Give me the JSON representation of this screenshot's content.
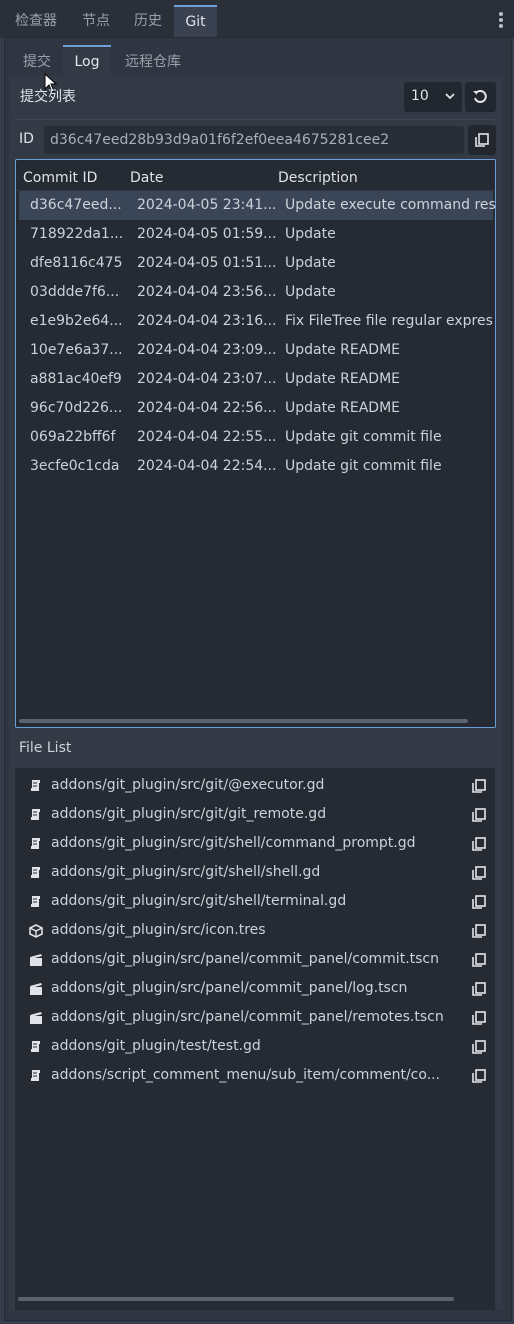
{
  "top_tabs": [
    "检查器",
    "节点",
    "历史",
    "Git"
  ],
  "sub_tabs": [
    "提交",
    "Log",
    "远程仓库"
  ],
  "commit_list": {
    "title": "提交列表",
    "count": "10",
    "id_label": "ID",
    "id_value": "d36c47eed28b93d9a01f6f2ef0eea4675281cee2"
  },
  "table": {
    "headers": [
      "Commit ID",
      "Date",
      "Description"
    ],
    "rows": [
      {
        "id": "d36c47eed...",
        "date": "2024-04-05 23:41...",
        "desc": "Update execute command res"
      },
      {
        "id": "718922da1...",
        "date": "2024-04-05 01:59...",
        "desc": "Update"
      },
      {
        "id": "dfe8116c475",
        "date": "2024-04-05 01:51...",
        "desc": "Update"
      },
      {
        "id": "03ddde7f6...",
        "date": "2024-04-04 23:56...",
        "desc": "Update"
      },
      {
        "id": "e1e9b2e64...",
        "date": "2024-04-04 23:16...",
        "desc": "Fix FileTree file regular expres"
      },
      {
        "id": "10e7e6a37...",
        "date": "2024-04-04 23:09...",
        "desc": "Update README"
      },
      {
        "id": "a881ac40ef9",
        "date": "2024-04-04 23:07...",
        "desc": "Update README"
      },
      {
        "id": "96c70d226...",
        "date": "2024-04-04 22:56...",
        "desc": "Update README"
      },
      {
        "id": "069a22bff6f",
        "date": "2024-04-04 22:55...",
        "desc": "Update git commit file"
      },
      {
        "id": "3ecfe0c1cda",
        "date": "2024-04-04 22:54...",
        "desc": "Update git commit file"
      }
    ]
  },
  "file_list": {
    "title": "File List",
    "files": [
      {
        "name": "addons/git_plugin/src/git/@executor.gd",
        "icon": "script-icon"
      },
      {
        "name": "addons/git_plugin/src/git/git_remote.gd",
        "icon": "script-icon"
      },
      {
        "name": "addons/git_plugin/src/git/shell/command_prompt.gd",
        "icon": "script-icon"
      },
      {
        "name": "addons/git_plugin/src/git/shell/shell.gd",
        "icon": "script-icon"
      },
      {
        "name": "addons/git_plugin/src/git/shell/terminal.gd",
        "icon": "script-icon"
      },
      {
        "name": "addons/git_plugin/src/icon.tres",
        "icon": "resource-icon"
      },
      {
        "name": "addons/git_plugin/src/panel/commit_panel/commit.tscn",
        "icon": "scene-icon"
      },
      {
        "name": "addons/git_plugin/src/panel/commit_panel/log.tscn",
        "icon": "scene-icon"
      },
      {
        "name": "addons/git_plugin/src/panel/commit_panel/remotes.tscn",
        "icon": "scene-icon"
      },
      {
        "name": "addons/git_plugin/test/test.gd",
        "icon": "script-icon"
      },
      {
        "name": "addons/script_comment_menu/sub_item/comment/co...",
        "icon": "script-icon"
      }
    ]
  },
  "colors": {
    "accent": "#6f9ed8",
    "panel_bg": "#252a33",
    "selected_row": "#3a4657"
  }
}
